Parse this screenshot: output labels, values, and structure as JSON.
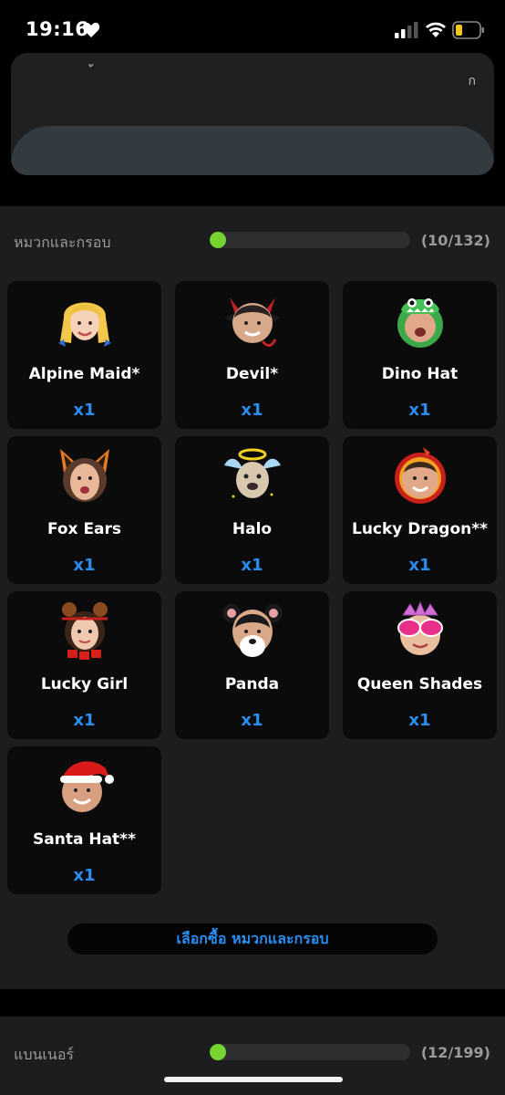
{
  "status_bar": {
    "time": "19:16"
  },
  "top_card": {
    "left_fragment": "้",
    "right_fragment": "ก"
  },
  "frames_section": {
    "title": "หมวกและกรอบ",
    "progress": {
      "collected": 10,
      "total": 132,
      "fraction": 0.0758,
      "label": "(10/132)"
    },
    "items": [
      {
        "name": "Alpine Maid*",
        "qty": "x1",
        "icon": "alpine-maid-icon"
      },
      {
        "name": "Devil*",
        "qty": "x1",
        "icon": "devil-horns-icon"
      },
      {
        "name": "Dino Hat",
        "qty": "x1",
        "icon": "dino-hat-icon"
      },
      {
        "name": "Fox Ears",
        "qty": "x1",
        "icon": "fox-ears-icon"
      },
      {
        "name": "Halo",
        "qty": "x1",
        "icon": "halo-icon"
      },
      {
        "name": "Lucky Dragon**",
        "qty": "x1",
        "icon": "lucky-dragon-icon"
      },
      {
        "name": "Lucky Girl",
        "qty": "x1",
        "icon": "lucky-girl-icon"
      },
      {
        "name": "Panda",
        "qty": "x1",
        "icon": "panda-icon"
      },
      {
        "name": "Queen Shades",
        "qty": "x1",
        "icon": "queen-shades-icon"
      },
      {
        "name": "Santa Hat**",
        "qty": "x1",
        "icon": "santa-hat-icon"
      }
    ],
    "buy_button": "เลือกซื้อ หมวกและกรอบ"
  },
  "banners_section": {
    "title": "แบนเนอร์",
    "progress": {
      "collected": 12,
      "total": 199,
      "fraction": 0.0603,
      "label": "(12/199)"
    }
  },
  "colors": {
    "accent_blue": "#2a8cf0",
    "progress_green": "#77d430",
    "tile_bg": "#0b0b0c",
    "section_bg": "#1d1d1f"
  }
}
